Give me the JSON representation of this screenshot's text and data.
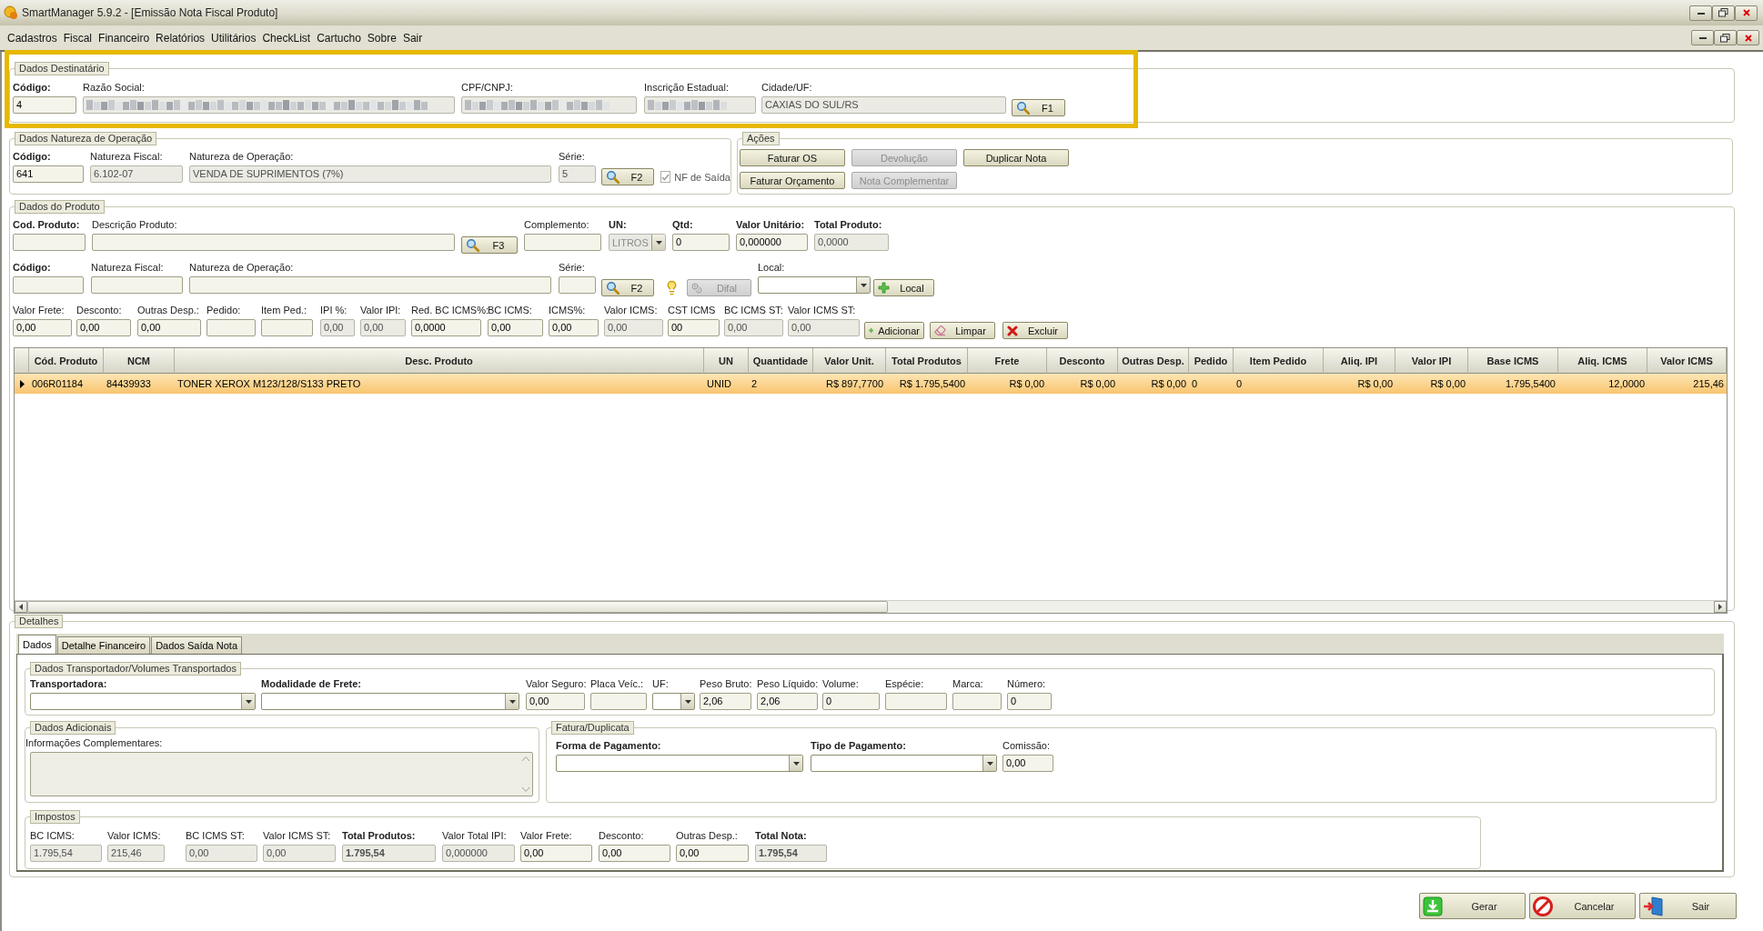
{
  "window": {
    "title": "SmartManager 5.9.2 - [Emissão Nota Fiscal Produto]"
  },
  "menu": [
    "Cadastros",
    "Fiscal",
    "Financeiro",
    "Relatórios",
    "Utilitários",
    "CheckList",
    "Cartucho",
    "Sobre",
    "Sair"
  ],
  "destinatario": {
    "title": "Dados Destinatário",
    "highlighted": true,
    "fields": [
      {
        "label": "Código:",
        "bold": true,
        "kind": "text",
        "value": "4",
        "disabled": false
      },
      {
        "label": "Razão Social:",
        "kind": "text",
        "blurred": true,
        "disabled": true
      },
      {
        "label": "CPF/CNPJ:",
        "kind": "text",
        "blurred": true,
        "disabled": true
      },
      {
        "label": "Inscrição Estadual:",
        "kind": "text",
        "blurred": true,
        "disabled": true
      },
      {
        "label": "Cidade/UF:",
        "kind": "text",
        "value": "CAXIAS DO SUL/RS",
        "disabled": true
      },
      {
        "kind": "search",
        "caption": "F1",
        "disabled": false
      }
    ]
  },
  "natureza": {
    "title": "Dados Natureza de Operação",
    "fields": [
      {
        "label": "Código:",
        "bold": true,
        "kind": "text",
        "value": "641",
        "disabled": false
      },
      {
        "label": "Natureza Fiscal:",
        "kind": "text",
        "value": "6.102-07",
        "disabled": true
      },
      {
        "label": "Natureza de Operação:",
        "kind": "text",
        "value": "VENDA DE SUPRIMENTOS (7%)",
        "disabled": true
      },
      {
        "label": "Série:",
        "kind": "text",
        "value": "5",
        "disabled": true
      },
      {
        "kind": "search",
        "caption": "F2",
        "disabled": false
      },
      {
        "kind": "check",
        "caption": "NF de Saída",
        "checked": true,
        "disabled": true
      }
    ]
  },
  "acoes": {
    "title": "Ações",
    "buttons": [
      {
        "caption": "Faturar OS",
        "disabled": false
      },
      {
        "caption": "Devolução",
        "disabled": true
      },
      {
        "caption": "Duplicar Nota",
        "disabled": false
      },
      {
        "caption": "Faturar Orçamento",
        "disabled": false
      },
      {
        "caption": "Nota Complementar",
        "disabled": true
      }
    ]
  },
  "produto": {
    "title": "Dados do Produto",
    "lines": [
      {
        "fields": [
          {
            "label": "Cod. Produto:",
            "bold": true,
            "kind": "text",
            "disabled": false
          },
          {
            "label": "Descrição Produto:",
            "kind": "text",
            "disabled": false
          },
          {
            "kind": "search",
            "caption": "F3",
            "disabled": false
          },
          {
            "label": "Complemento:",
            "kind": "text",
            "disabled": false
          },
          {
            "label": "UN:",
            "bold": true,
            "kind": "combo",
            "value": "LITROS",
            "disabled": true
          },
          {
            "label": "Qtd:",
            "bold": true,
            "kind": "text",
            "value": "0",
            "disabled": false
          },
          {
            "label": "Valor Unitário:",
            "bold": true,
            "kind": "text",
            "value": "0,000000",
            "disabled": false
          },
          {
            "label": "Total Produto:",
            "bold": true,
            "kind": "text",
            "value": "0,0000",
            "disabled": true
          }
        ]
      },
      {
        "fields": [
          {
            "label": "Código:",
            "bold": true,
            "kind": "text",
            "disabled": false
          },
          {
            "label": "Natureza Fiscal:",
            "kind": "text",
            "disabled": false
          },
          {
            "label": "Natureza de Operação:",
            "kind": "text",
            "disabled": false
          },
          {
            "label": "Série:",
            "kind": "text",
            "disabled": false
          },
          {
            "kind": "search",
            "caption": "F2",
            "disabled": false
          },
          {
            "kind": "bulb"
          },
          {
            "kind": "difal",
            "caption": "Difal",
            "disabled": true
          },
          {
            "label": "Local:",
            "kind": "combo",
            "disabled": false
          },
          {
            "kind": "add",
            "caption": "Local",
            "disabled": false
          }
        ]
      },
      {
        "fields": [
          {
            "label": "Valor Frete:",
            "kind": "text",
            "value": "0,00",
            "disabled": false
          },
          {
            "label": "Desconto:",
            "kind": "text",
            "value": "0,00",
            "disabled": false
          },
          {
            "label": "Outras Desp.:",
            "kind": "text",
            "value": "0,00",
            "disabled": false
          },
          {
            "label": "Pedido:",
            "kind": "text",
            "disabled": false
          },
          {
            "label": "Item Ped.:",
            "kind": "text",
            "disabled": false
          },
          {
            "label": "IPI %:",
            "kind": "text",
            "value": "0,00",
            "disabled": true
          },
          {
            "label": "Valor IPI:",
            "kind": "text",
            "value": "0,00",
            "disabled": true
          },
          {
            "label": "Red. BC ICMS%:",
            "kind": "text",
            "value": "0,0000",
            "disabled": false
          },
          {
            "label": "BC ICMS:",
            "kind": "text",
            "value": "0,00",
            "disabled": false
          },
          {
            "label": "ICMS%:",
            "kind": "text",
            "value": "0,00",
            "disabled": false
          },
          {
            "label": "Valor ICMS:",
            "kind": "text",
            "value": "0,00",
            "disabled": true
          },
          {
            "label": "CST ICMS",
            "kind": "text",
            "value": "00",
            "disabled": false
          },
          {
            "label": "BC ICMS ST:",
            "kind": "text",
            "value": "0,00",
            "disabled": true
          },
          {
            "label": "Valor ICMS ST:",
            "kind": "text",
            "value": "0,00",
            "disabled": true
          },
          {
            "kind": "add",
            "caption": "Adicionar",
            "disabled": false
          },
          {
            "kind": "clear",
            "caption": "Limpar",
            "disabled": false
          },
          {
            "kind": "remove",
            "caption": "Excluir",
            "disabled": false
          }
        ]
      }
    ]
  },
  "table": {
    "columns": [
      "Cód. Produto",
      "NCM",
      "Desc. Produto",
      "UN",
      "Quantidade",
      "Valor Unit.",
      "Total Produtos",
      "Frete",
      "Desconto",
      "Outras Desp.",
      "Pedido",
      "Item Pedido",
      "Aliq. IPI",
      "Valor IPI",
      "Base ICMS",
      "Aliq. ICMS",
      "Valor ICMS"
    ],
    "rows": [
      {
        "selected": true,
        "cells": [
          "006R01184",
          "84439933",
          "TONER XEROX M123/128/S133 PRETO",
          "UNID",
          "2",
          "R$ 897,7700",
          "R$ 1.795,5400",
          "R$ 0,00",
          "R$ 0,00",
          "R$ 0,00",
          "0",
          "0",
          "R$ 0,00",
          "R$ 0,00",
          "1.795,5400",
          "12,0000",
          "215,46"
        ]
      }
    ]
  },
  "detalhes": {
    "title": "Detalhes",
    "tabs": [
      {
        "label": "Dados",
        "selected": true
      },
      {
        "label": "Detalhe Financeiro",
        "selected": false
      },
      {
        "label": "Dados Saída Nota",
        "selected": false
      }
    ],
    "transportador": {
      "title": "Dados Transportador/Volumes Transportados",
      "fields": [
        {
          "label": "Transportadora:",
          "bold": true,
          "kind": "combo",
          "disabled": false
        },
        {
          "label": "Modalidade de Frete:",
          "bold": true,
          "kind": "combo",
          "disabled": false
        },
        {
          "label": "Valor Seguro:",
          "kind": "text",
          "value": "0,00",
          "disabled": false
        },
        {
          "label": "Placa Veíc.:",
          "kind": "text",
          "disabled": false
        },
        {
          "label": "UF:",
          "kind": "combo",
          "disabled": false
        },
        {
          "label": "Peso Bruto:",
          "kind": "text",
          "value": "2,06",
          "disabled": false
        },
        {
          "label": "Peso Líquido:",
          "kind": "text",
          "value": "2,06",
          "disabled": false
        },
        {
          "label": "Volume:",
          "kind": "text",
          "value": "0",
          "disabled": false
        },
        {
          "label": "Espécie:",
          "kind": "text",
          "disabled": false
        },
        {
          "label": "Marca:",
          "kind": "text",
          "disabled": false
        },
        {
          "label": "Número:",
          "kind": "text",
          "value": "0",
          "disabled": false
        }
      ]
    },
    "adicionais": {
      "title": "Dados Adicionais",
      "label": "Informações Complementares:"
    },
    "fatura": {
      "title": "Fatura/Duplicata",
      "fields": [
        {
          "label": "Forma de Pagamento:",
          "bold": true,
          "kind": "combo",
          "disabled": false
        },
        {
          "label": "Tipo de Pagamento:",
          "bold": true,
          "kind": "combo",
          "disabled": false
        },
        {
          "label": "Comissão:",
          "kind": "text",
          "value": "0,00",
          "disabled": false
        }
      ]
    },
    "impostos": {
      "title": "Impostos",
      "fields": [
        {
          "label": "BC ICMS:",
          "kind": "text",
          "value": "1.795,54",
          "disabled": true
        },
        {
          "label": "Valor ICMS:",
          "kind": "text",
          "value": "215,46",
          "disabled": true
        },
        {
          "label": "BC ICMS ST:",
          "kind": "text",
          "value": "0,00",
          "disabled": true
        },
        {
          "label": "Valor ICMS ST:",
          "kind": "text",
          "value": "0,00",
          "disabled": true
        },
        {
          "label": "Total Produtos:",
          "bold": true,
          "strong": true,
          "kind": "text",
          "value": "1.795,54",
          "disabled": true
        },
        {
          "label": "Valor Total IPI:",
          "kind": "text",
          "value": "0,000000",
          "disabled": true
        },
        {
          "label": "Valor Frete:",
          "kind": "text",
          "value": "0,00",
          "disabled": false
        },
        {
          "label": "Desconto:",
          "kind": "text",
          "value": "0,00",
          "disabled": false
        },
        {
          "label": "Outras Desp.:",
          "kind": "text",
          "value": "0,00",
          "disabled": false
        },
        {
          "label": "Total Nota:",
          "bold": true,
          "strong": true,
          "kind": "text",
          "value": "1.795,54",
          "disabled": true
        }
      ]
    }
  },
  "footer_buttons": [
    {
      "caption": "Gerar",
      "kind": "generate"
    },
    {
      "caption": "Cancelar",
      "kind": "cancel"
    },
    {
      "caption": "Sair",
      "kind": "exit"
    }
  ]
}
